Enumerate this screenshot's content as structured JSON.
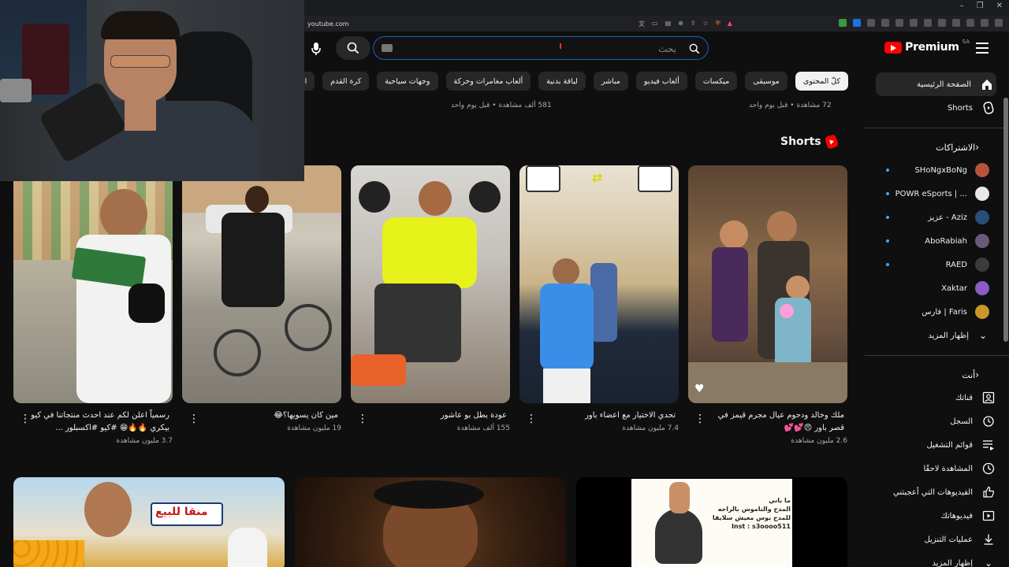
{
  "browser": {
    "url": "youtube.com",
    "minimize": "–",
    "restore": "❐",
    "close": "✕"
  },
  "header": {
    "search_placeholder": "بحث",
    "logo_text": "Premium",
    "country_code": "SA"
  },
  "chips": [
    "كلّ المحتوى",
    "موسيقى",
    "ميكسات",
    "ألعاب فيديو",
    "مباشر",
    "لياقة بدنية",
    "ألعاب مغامرات وحركة",
    "وجهات سياحية",
    "كرة القدم",
    "القنوات التي تم تحميلها مؤخرًا"
  ],
  "top_row_meta": [
    "72 مشاهدة • قبل يوم واحد",
    "581 ألف مشاهدة • قبل يوم واحد"
  ],
  "sidebar": {
    "main": [
      {
        "label": "الصفحة الرئيسية",
        "icon": "home-icon"
      },
      {
        "label": "Shorts",
        "icon": "shorts-icon"
      }
    ],
    "subscriptions_heading": "الاشتراكات",
    "subscriptions": [
      {
        "label": "SHoNgxBoNg",
        "color": "#b5533c",
        "live": true
      },
      {
        "label": "POWR eSports | ...",
        "color": "#e8e8e8",
        "live": true
      },
      {
        "label": "عزيز - Aziz",
        "color": "#2a4d7a",
        "live": true
      },
      {
        "label": "AboRabiah",
        "color": "#6a5a7a",
        "live": true
      },
      {
        "label": "RAED",
        "color": "#3b3b3b",
        "live": true
      },
      {
        "label": "Xaktar",
        "color": "#8b5cc6",
        "live": false
      },
      {
        "label": "فارس | Faris",
        "color": "#c9962a",
        "live": false
      }
    ],
    "show_more": "إظهار المزيد",
    "you_heading": "أنت",
    "you_items": [
      {
        "label": "قناتك",
        "icon": "channel-icon"
      },
      {
        "label": "السجل",
        "icon": "history-icon"
      },
      {
        "label": "قوائم التشغيل",
        "icon": "playlists-icon"
      },
      {
        "label": "المشاهدة لاحقًا",
        "icon": "watch-later-icon"
      },
      {
        "label": "الفيديوهات التي أعجبتني",
        "icon": "liked-icon"
      },
      {
        "label": "فيديوهاتك",
        "icon": "your-videos-icon"
      },
      {
        "label": "عمليات التنزيل",
        "icon": "downloads-icon"
      }
    ],
    "show_more_bottom": "إظهار المزيد"
  },
  "shorts": {
    "heading": "Shorts",
    "items": [
      {
        "title": "ملك وخالد ودحوم عيال مجرم قيمز في قصر باور 😠💕💕",
        "views": "2.6 مليون مشاهدة"
      },
      {
        "title": "تحدي الاختيار مع اعضاء باور",
        "views": "7.4 مليون مشاهدة"
      },
      {
        "title": "عودة بطل بو عاشور",
        "views": "155 ألف مشاهدة"
      },
      {
        "title": "مين كان يسويها؟😂",
        "views": "19 مليون مشاهدة"
      },
      {
        "title": "رسمياً اعلن لكم عند احدث منتجاتنا في كيو بيكري 🔥🔥😁 #كيو #اكسبلور ...",
        "views": "3.7 مليون مشاهدة"
      }
    ]
  },
  "bottom_row": {
    "card1_sign": "منقا للبيع",
    "card3_caption": "ما باني\nالمدح والناموس بالراحه\nللمدح بوس معيش سلايقا\nInst : s3oooo511"
  }
}
